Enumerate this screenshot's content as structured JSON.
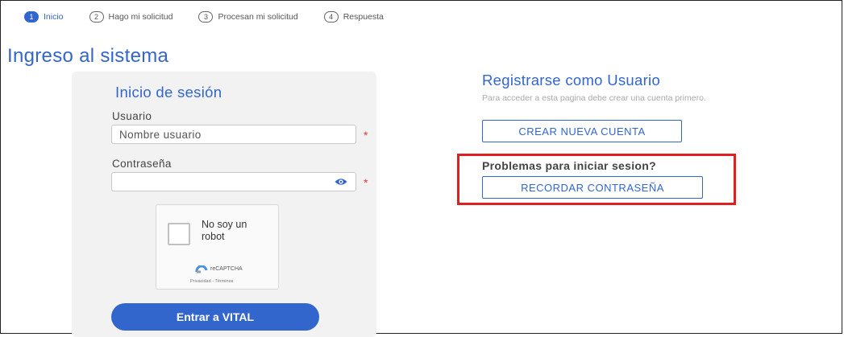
{
  "steps": [
    {
      "num": "1",
      "label": "Inicio",
      "active": true
    },
    {
      "num": "2",
      "label": "Hago mi solicitud",
      "active": false
    },
    {
      "num": "3",
      "label": "Procesan mi solicitud",
      "active": false
    },
    {
      "num": "4",
      "label": "Respuesta",
      "active": false
    }
  ],
  "page_title": "Ingreso al sistema",
  "login": {
    "title": "Inicio de sesión",
    "user_label": "Usuario",
    "user_placeholder": "Nombre usuario",
    "user_required": "*",
    "password_label": "Contraseña",
    "password_placeholder": "",
    "password_required": "*",
    "password_icon": "eye-icon",
    "captcha": {
      "label": "No soy un robot",
      "brand": "reCAPTCHA",
      "terms": "Privacidad - Términos"
    },
    "submit_label": "Entrar a VITAL"
  },
  "register": {
    "title": "Registrarse como Usuario",
    "subtitle": "Para acceder a esta pagina debe crear una cuenta primero.",
    "new_account_label": "CREAR NUEVA CUENTA",
    "problems_label": "Problemas para iniciar sesion?",
    "recall_label": "RECORDAR CONTRASEÑA"
  },
  "colors": {
    "accent": "#3366cc",
    "highlight": "#e02020",
    "required": "#e03a3a"
  }
}
